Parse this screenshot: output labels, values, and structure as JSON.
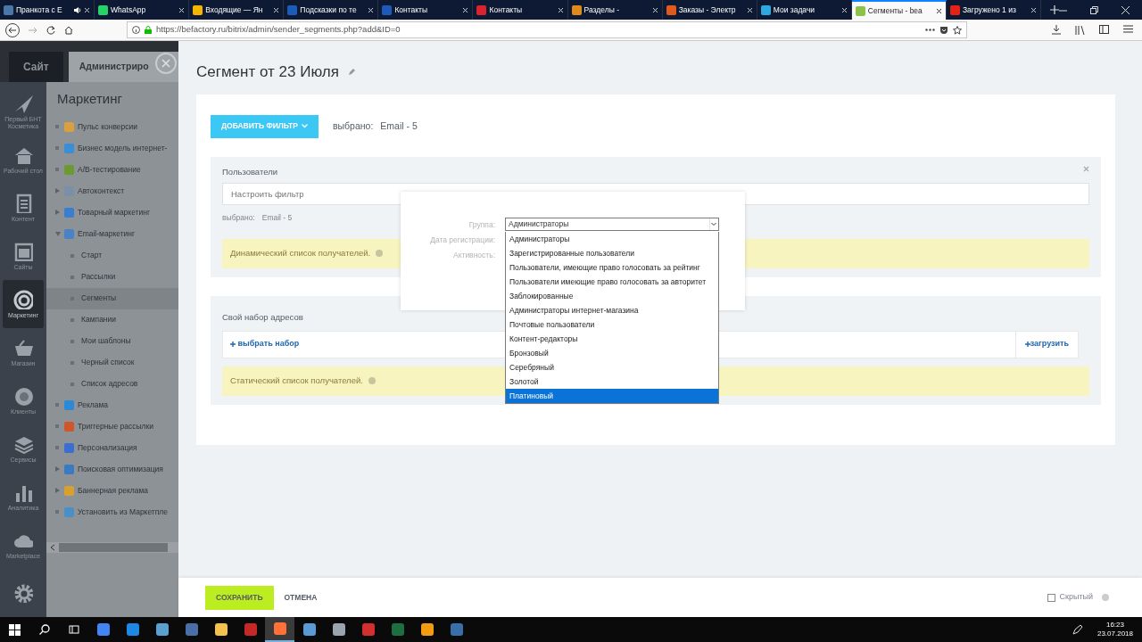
{
  "browser": {
    "tabs": [
      {
        "label": "Пранкота с Е",
        "selected": false,
        "sound": true,
        "color": "#4a76a8"
      },
      {
        "label": "WhatsApp",
        "selected": false,
        "sound": false,
        "color": "#25d366"
      },
      {
        "label": "Входящие — Ян",
        "selected": false,
        "sound": false,
        "color": "#f5b400"
      },
      {
        "label": "Подсказки по те",
        "selected": false,
        "sound": false,
        "color": "#1e5bb8"
      },
      {
        "label": "Контакты",
        "selected": false,
        "sound": false,
        "color": "#1e5bb8"
      },
      {
        "label": "Контакты",
        "selected": false,
        "sound": false,
        "color": "#d9232e"
      },
      {
        "label": "Разделы -",
        "selected": false,
        "sound": false,
        "color": "#e08a1e"
      },
      {
        "label": "Заказы - Электр",
        "selected": false,
        "sound": false,
        "color": "#e05a1e"
      },
      {
        "label": "Мои задачи",
        "selected": false,
        "sound": false,
        "color": "#2fa7e0"
      },
      {
        "label": "Сегменты - bea",
        "selected": true,
        "sound": false,
        "color": "#8bc34a"
      },
      {
        "label": "Загружено 1 из",
        "selected": false,
        "sound": false,
        "color": "#e62117"
      }
    ],
    "url": "https://befactory.ru/bitrix/admin/sender_segments.php?add&ID=0"
  },
  "admin": {
    "top_tabs": [
      {
        "label": "Сайт",
        "selected": false
      },
      {
        "label": "Администриро",
        "selected": true
      }
    ],
    "nav": [
      {
        "label": "Первый БНТ Косметика",
        "kind": "plane",
        "selected": false
      },
      {
        "label": "Рабочий стол",
        "kind": "home",
        "selected": false
      },
      {
        "label": "Контент",
        "kind": "document",
        "selected": false
      },
      {
        "label": "Сайты",
        "kind": "calendar",
        "selected": false
      },
      {
        "label": "Маркетинг",
        "kind": "target",
        "selected": true
      },
      {
        "label": "Магазин",
        "kind": "basket",
        "selected": false
      },
      {
        "label": "Клиенты",
        "kind": "badge",
        "selected": false
      },
      {
        "label": "Сервисы",
        "kind": "layers",
        "selected": false
      },
      {
        "label": "Аналитика",
        "kind": "chart",
        "selected": false
      },
      {
        "label": "Marketplace",
        "kind": "cloud",
        "selected": false
      },
      {
        "kind": "gear",
        "selected": false
      }
    ],
    "menu": {
      "title": "Маркетинг",
      "items": [
        {
          "label": "Пульс конверсии",
          "collapsible": false,
          "color": "#d9a040",
          "selected": false
        },
        {
          "label": "Бизнес модель интернет-",
          "collapsible": false,
          "color": "#3a8ed8",
          "selected": false
        },
        {
          "label": "А/В-тестирование",
          "collapsible": false,
          "color": "#6a9a30",
          "selected": false
        },
        {
          "label": "Автоконтекст",
          "collapsible": true,
          "expanded": false,
          "color": "#7a8fa8",
          "selected": false
        },
        {
          "label": "Товарный маркетинг",
          "collapsible": true,
          "expanded": false,
          "color": "#3a7ed0",
          "selected": false
        },
        {
          "label": "Email-маркетинг",
          "collapsible": true,
          "expanded": true,
          "color": "#4a82c8",
          "selected": false,
          "children": [
            {
              "label": "Старт",
              "selected": false
            },
            {
              "label": "Рассылки",
              "selected": false
            },
            {
              "label": "Сегменты",
              "selected": true
            },
            {
              "label": "Кампании",
              "selected": false
            },
            {
              "label": "Мои шаблоны",
              "selected": false
            },
            {
              "label": "Черный список",
              "selected": false
            },
            {
              "label": "Список адресов",
              "selected": false
            }
          ]
        },
        {
          "label": "Реклама",
          "collapsible": false,
          "color": "#2a8ad8",
          "selected": false
        },
        {
          "label": "Триггерные рассылки",
          "collapsible": false,
          "color": "#d0562a",
          "selected": false
        },
        {
          "label": "Персонализация",
          "collapsible": false,
          "color": "#3a6ed0",
          "selected": false
        },
        {
          "label": "Поисковая оптимизация",
          "collapsible": true,
          "expanded": false,
          "color": "#3a7ac0",
          "selected": false
        },
        {
          "label": "Баннерная реклама",
          "collapsible": true,
          "expanded": false,
          "color": "#d8a030",
          "selected": false
        },
        {
          "label": "Установить из Маркетпле",
          "collapsible": false,
          "color": "#4a90c8",
          "selected": false
        }
      ]
    }
  },
  "page": {
    "title": "Сегмент от 23 Июля",
    "add_filter": "ДОБАВИТЬ ФИЛЬТР",
    "selected_label": "выбрано:",
    "selected_value": "Email - 5",
    "users": {
      "title": "Пользователи",
      "filter_placeholder": "Настроить фильтр",
      "selected_label": "выбрано:",
      "selected_value": "Email - 5",
      "note": "Динамический список получателей."
    },
    "addresses": {
      "title": "Свой набор адресов",
      "choose": "выбрать набор",
      "upload": "загрузить",
      "note": "Статический список получателей."
    },
    "filter_popup": {
      "fields": [
        "Группа:",
        "Дата регистрации:",
        "Активность:"
      ],
      "group_value": "Администраторы",
      "options": [
        {
          "label": "Администраторы",
          "selected": false
        },
        {
          "label": "Зарегистрированные пользователи",
          "selected": false
        },
        {
          "label": "Пользователи, имеющие право голосовать за рейтинг",
          "selected": false
        },
        {
          "label": "Пользователи имеющие право голосовать за авторитет",
          "selected": false
        },
        {
          "label": "Заблокированные",
          "selected": false
        },
        {
          "label": "Администраторы интернет-магазина",
          "selected": false
        },
        {
          "label": "Почтовые пользователи",
          "selected": false
        },
        {
          "label": "Контент-редакторы",
          "selected": false
        },
        {
          "label": "Бронзовый",
          "selected": false
        },
        {
          "label": "Серебряный",
          "selected": false
        },
        {
          "label": "Золотой",
          "selected": false
        },
        {
          "label": "Платиновый",
          "selected": true
        }
      ]
    },
    "footer": {
      "save": "СОХРАНИТЬ",
      "cancel": "ОТМЕНА",
      "hidden_label": "Скрытый",
      "hidden_checked": false
    }
  },
  "taskbar": {
    "apps": [
      {
        "color": "#4285f4",
        "active": false
      },
      {
        "color": "#1e88e5",
        "active": false
      },
      {
        "color": "#5aa0d0",
        "active": false
      },
      {
        "color": "#4a6fa8",
        "active": false
      },
      {
        "color": "#f2c14e",
        "active": false
      },
      {
        "color": "#c62828",
        "active": false
      },
      {
        "color": "#ff7139",
        "active": true
      },
      {
        "color": "#5b9bd5",
        "active": false
      },
      {
        "color": "#9aa4ae",
        "active": false
      },
      {
        "color": "#d32f2f",
        "active": false
      },
      {
        "color": "#1d6f42",
        "active": false
      },
      {
        "color": "#f39c12",
        "active": false
      },
      {
        "color": "#3a6ea8",
        "active": false
      }
    ],
    "time": "16:23",
    "date": "23.07.2018"
  }
}
